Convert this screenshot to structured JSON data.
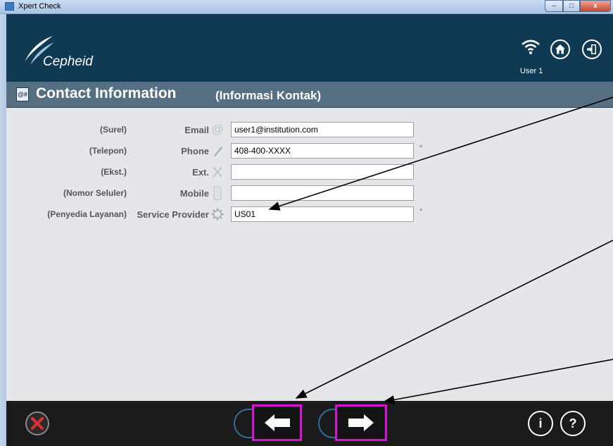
{
  "window": {
    "title": "Xpert Check",
    "min_label": "–",
    "max_label": "□",
    "close_label": "x"
  },
  "header": {
    "logo_text": "Cepheid",
    "user_label": "User 1"
  },
  "section": {
    "title": "Contact Information",
    "subtitle": "(Informasi Kontak)",
    "icon_text": "@#"
  },
  "form": {
    "fields": [
      {
        "translation": "(Surel)",
        "label": "Email",
        "icon": "at-icon",
        "value": "user1@institution.com",
        "required": false
      },
      {
        "translation": "(Telepon)",
        "label": "Phone",
        "icon": "phone-icon",
        "value": "408-400-XXXX",
        "required": true
      },
      {
        "translation": "(Ekst.)",
        "label": "Ext.",
        "icon": "x-icon",
        "value": "",
        "required": false
      },
      {
        "translation": "(Nomor Seluler)",
        "label": "Mobile",
        "icon": "mobile-icon",
        "value": "",
        "required": false
      },
      {
        "translation": "(Penyedia Layanan)",
        "label": "Service Provider",
        "icon": "gear-icon",
        "value": "US01",
        "required": true
      }
    ],
    "required_mark": "*"
  },
  "footer": {
    "info_label": "i",
    "help_label": "?"
  },
  "colors": {
    "header_bg": "#103a54",
    "section_bg": "#566f82",
    "content_bg": "#e4e6e9",
    "footer_bg": "#1b1b1b",
    "highlight": "#d613d6",
    "cancel_red": "#e03131"
  }
}
